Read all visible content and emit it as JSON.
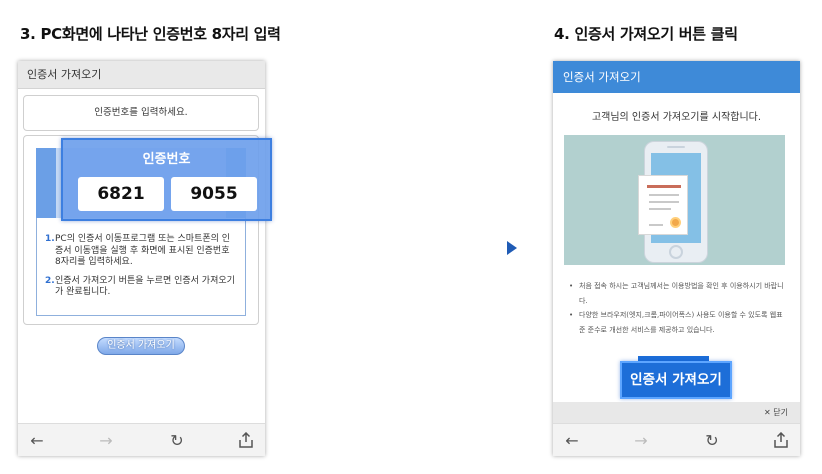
{
  "steps": {
    "step3_title": "3. PC화면에 나타난 인증번호 8자리 입력",
    "step4_title": "4. 인증서 가져오기 버튼 클릭"
  },
  "left_phone": {
    "title": "인증서 가져오기",
    "prompt": "인증번호를 입력하세요.",
    "instructions": [
      {
        "num": "1.",
        "text": "PC의 인증서 이동프로그램 또는 스마트폰의 인증서 이동앱을 실행 후 화면에 표시된 인증번호 8자리를 입력하세요."
      },
      {
        "num": "2.",
        "text": "인증서 가져오기 버튼을 누르면 인증서 가져오기가 완료됩니다."
      }
    ],
    "button_label": "인증서 가져오기"
  },
  "code_overlay": {
    "title": "인증번호",
    "code_part1": "6821",
    "code_part2": "9055"
  },
  "right_phone": {
    "title": "인증서 가져오기",
    "intro": "고객님의 인증서 가져오기를 시작합니다.",
    "notes": [
      "처음 접속 하시는 고객님께서는 이용방법을 확인 후 이용하시기 바랍니다.",
      "다양한 브라우저(엣지,크롬,파이어폭스) 사용도 이용할 수 있도록 웹표준 준수로 개선한 서비스를 제공하고 있습니다."
    ],
    "bullet": "•",
    "button_label": "인증서 가져오기",
    "close_label": "✕ 닫기"
  },
  "nav_icons": {
    "back": "back-arrow-icon",
    "forward": "forward-arrow-icon",
    "refresh": "refresh-icon",
    "share": "share-icon"
  },
  "colors": {
    "accent_blue": "#3e8ad8",
    "button_blue": "#1d6ed8",
    "highlight": "#6ea0eb",
    "illustration_bg": "#b2d0cf"
  }
}
